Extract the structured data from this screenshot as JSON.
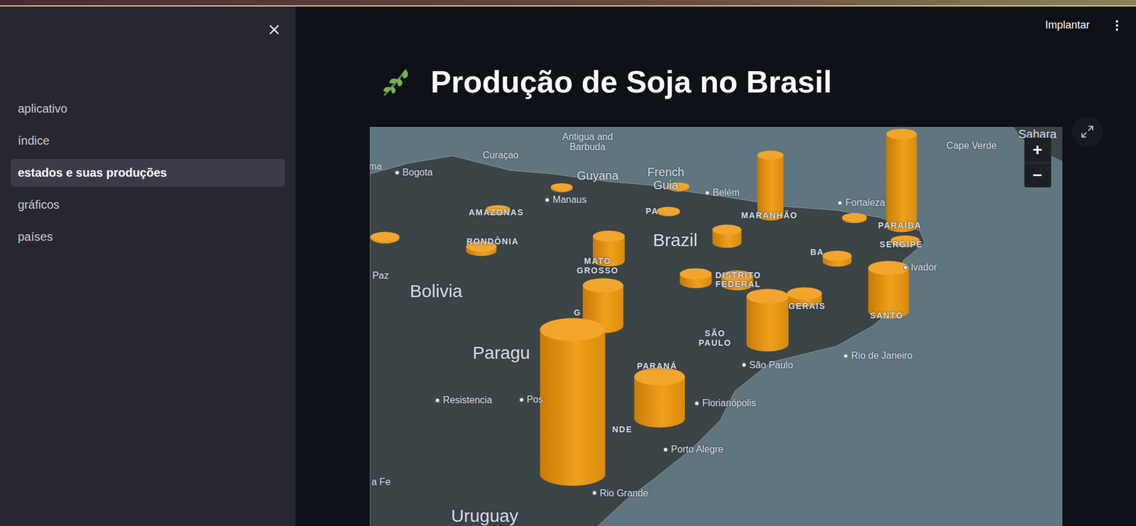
{
  "sidebar": {
    "items": [
      {
        "label": "aplicativo",
        "selected": false
      },
      {
        "label": "índice",
        "selected": false
      },
      {
        "label": "estados e suas produções",
        "selected": true
      },
      {
        "label": "gráficos",
        "selected": false
      },
      {
        "label": "países",
        "selected": false
      }
    ]
  },
  "header": {
    "deploy": "Implantar"
  },
  "page": {
    "title": "Produção de Soja no Brasil"
  },
  "map": {
    "zoom": {
      "in": "+",
      "out": "−"
    },
    "labels": [
      {
        "text": "Antigua and\nBarbuda",
        "kind": "place"
      },
      {
        "text": "Curaçao",
        "kind": "place"
      },
      {
        "text": "ma",
        "kind": "place"
      },
      {
        "text": "Bogota",
        "kind": "city"
      },
      {
        "text": "Guyana",
        "kind": "region"
      },
      {
        "text": "French\nGuia",
        "kind": "region"
      },
      {
        "text": "Cape Verde",
        "kind": "place"
      },
      {
        "text": "Sahara",
        "kind": "region"
      },
      {
        "text": "Manaus",
        "kind": "city"
      },
      {
        "text": "Belém",
        "kind": "city"
      },
      {
        "text": "AMAZONAS",
        "kind": "state"
      },
      {
        "text": "PA",
        "kind": "state"
      },
      {
        "text": "MARANHÃO",
        "kind": "state"
      },
      {
        "text": "Fortaleza",
        "kind": "city"
      },
      {
        "text": "PARAÍBA",
        "kind": "state"
      },
      {
        "text": "SERGIPE",
        "kind": "state"
      },
      {
        "text": "Brazil",
        "kind": "country"
      },
      {
        "text": "RONDÔNIA",
        "kind": "state"
      },
      {
        "text": "BA",
        "kind": "state"
      },
      {
        "text": "lvador",
        "kind": "city"
      },
      {
        "text": "MATO\nGROSSO",
        "kind": "state"
      },
      {
        "text": "Paz",
        "kind": "city"
      },
      {
        "text": "Bolivia",
        "kind": "country"
      },
      {
        "text": "DISTRITO\nFEDERAL",
        "kind": "state"
      },
      {
        "text": "GERAIS",
        "kind": "state"
      },
      {
        "text": "SANTO",
        "kind": "state"
      },
      {
        "text": "G",
        "kind": "state"
      },
      {
        "text": "SÃO\nPAULO",
        "kind": "state"
      },
      {
        "text": "Paragu",
        "kind": "country"
      },
      {
        "text": "Rio de Janeiro",
        "kind": "city"
      },
      {
        "text": "São Paulo",
        "kind": "city"
      },
      {
        "text": "PARANÁ",
        "kind": "state"
      },
      {
        "text": "Resistencia",
        "kind": "city"
      },
      {
        "text": "Pos",
        "kind": "city"
      },
      {
        "text": "Florianópolis",
        "kind": "city"
      },
      {
        "text": "NDE",
        "kind": "state"
      },
      {
        "text": "Porto Alegre",
        "kind": "city"
      },
      {
        "text": "a Fe",
        "kind": "place"
      },
      {
        "text": "Rio Grande",
        "kind": "city"
      },
      {
        "text": "Uruguay",
        "kind": "country"
      }
    ],
    "columns": [
      {
        "level": 0.01
      },
      {
        "level": 0.01
      },
      {
        "level": 0.01
      },
      {
        "level": 0.01
      },
      {
        "level": 0.01
      },
      {
        "level": 0.01
      },
      {
        "level": 0.01
      },
      {
        "level": 0.03
      },
      {
        "level": 0.04
      },
      {
        "level": 0.06
      },
      {
        "level": 0.06
      },
      {
        "level": 0.05
      },
      {
        "level": 0.09
      },
      {
        "level": 0.17
      },
      {
        "level": 0.42
      },
      {
        "level": 0.64
      },
      {
        "level": 0.3
      },
      {
        "level": 0.33
      },
      {
        "level": 0.28
      },
      {
        "level": 0.29
      },
      {
        "level": 1.0
      }
    ]
  }
}
